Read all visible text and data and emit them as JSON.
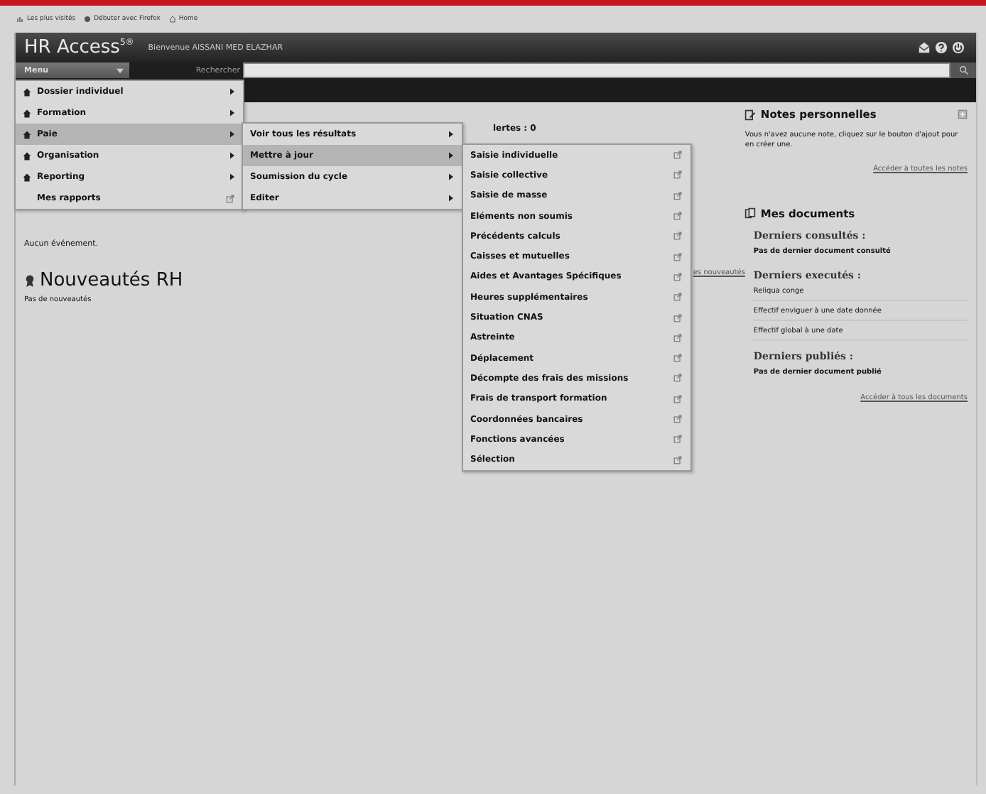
{
  "bookmarks": [
    "Les plus visités",
    "Débuter avec Firefox",
    "Home"
  ],
  "header": {
    "logo": "HR Access$^{5®}$",
    "welcome": "Bienvenue AISSANI MED ELAZHAR"
  },
  "navbar": {
    "menu_button": "Menu",
    "search_label": "Rechercher"
  },
  "menu": [
    {
      "label": "Dossier individuel",
      "kind": "submenu",
      "selected": false
    },
    {
      "label": "Formation",
      "kind": "submenu",
      "selected": false
    },
    {
      "label": "Paie",
      "kind": "submenu",
      "selected": true
    },
    {
      "label": "Organisation",
      "kind": "submenu",
      "selected": false
    },
    {
      "label": "Reporting",
      "kind": "submenu",
      "selected": false
    },
    {
      "label": "Mes rapports",
      "kind": "link",
      "selected": false
    }
  ],
  "submenu": [
    {
      "label": "Voir tous les résultats",
      "selected": false
    },
    {
      "label": "Mettre à jour",
      "selected": true
    },
    {
      "label": "Soumission du cycle",
      "selected": false
    },
    {
      "label": "Editer",
      "selected": false
    }
  ],
  "subsubmenu": [
    "Saisie individuelle",
    "Saisie collective",
    "Saisie de masse",
    "Eléments non soumis",
    "Précédents calculs",
    "Caisses et mutuelles",
    "Aides et Avantages Spécifiques",
    "Heures supplémentaires",
    "Situation CNAS",
    "Astreinte",
    "Déplacement",
    "Décompte des frais des missions",
    "Frais de transport formation",
    "Coordonnées bancaires",
    "Fonctions avancées",
    "Sélection"
  ],
  "main": {
    "alerts_title": "lertes : 0",
    "events_empty": "Aucun événement.",
    "news_title": "Nouveautés RH",
    "news_empty": "Pas de nouveautés",
    "news_link": "es nouveautés"
  },
  "notes": {
    "title": "Notes personnelles",
    "text": "Vous n'avez aucune note, cliquez sur le bouton d'ajout pour en créer une.",
    "link": "Accéder à toutes les notes"
  },
  "documents": {
    "title": "Mes documents",
    "sections": [
      {
        "title": "Derniers consultés :",
        "items": [
          {
            "label": "Pas de dernier document consulté",
            "kind": "empty"
          }
        ]
      },
      {
        "title": "Derniers executés :",
        "items": [
          {
            "label": "Reliqua conge",
            "kind": "document"
          },
          {
            "label": "Effectif enviguer à une date donnée",
            "kind": "document"
          },
          {
            "label": "Effectif global à une date",
            "kind": "document"
          }
        ]
      },
      {
        "title": "Derniers publiés :",
        "items": [
          {
            "label": "Pas de dernier document publié",
            "kind": "empty"
          }
        ]
      }
    ],
    "link": "Accéder à tous les documents"
  }
}
